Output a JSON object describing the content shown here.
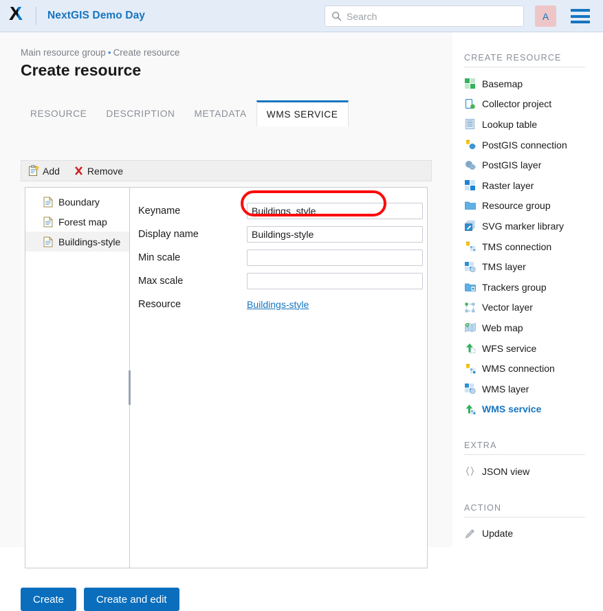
{
  "header": {
    "logo_name": "nextgis-logo",
    "site_title": "NextGIS Demo Day",
    "search_placeholder": "Search",
    "search_value": "",
    "avatar_letter": "A",
    "avatar_bg": "#eec6c8",
    "avatar_color": "#1675c0",
    "menu_name": "hamburger-menu",
    "bg": "#e4ecf7",
    "brand_color": "#1675c0"
  },
  "breadcrumb": {
    "parent": "Main resource group",
    "separator": "•",
    "current": "Create resource"
  },
  "page": {
    "title": "Create resource"
  },
  "tabs": [
    {
      "label": "RESOURCE",
      "active": false
    },
    {
      "label": "DESCRIPTION",
      "active": false
    },
    {
      "label": "METADATA",
      "active": false
    },
    {
      "label": "WMS SERVICE",
      "active": true
    }
  ],
  "toolbar": {
    "add_label": "Add",
    "remove_label": "Remove"
  },
  "item_list": [
    {
      "label": "Boundary",
      "selected": false
    },
    {
      "label": "Forest map",
      "selected": false
    },
    {
      "label": "Buildings-style",
      "selected": true
    }
  ],
  "form": {
    "rows": [
      {
        "label": "Keyname",
        "value": "Buildings_style",
        "type": "input"
      },
      {
        "label": "Display name",
        "value": "Buildings-style",
        "type": "input"
      },
      {
        "label": "Min scale",
        "value": "",
        "type": "input"
      },
      {
        "label": "Max scale",
        "value": "",
        "type": "input"
      },
      {
        "label": "Resource",
        "value": "Buildings-style",
        "type": "link"
      }
    ],
    "highlight_color": "#fc0b0b",
    "highlighted_field": "Keyname"
  },
  "buttons": {
    "create": "Create",
    "create_and_edit": "Create and edit",
    "primary_color": "#0a6ebd"
  },
  "sidebar": {
    "create_heading": "CREATE RESOURCE",
    "create_items": [
      {
        "label": "Basemap",
        "icon": "basemap-icon",
        "active": false
      },
      {
        "label": "Collector project",
        "icon": "collector-project-icon",
        "active": false
      },
      {
        "label": "Lookup table",
        "icon": "lookup-table-icon",
        "active": false
      },
      {
        "label": "PostGIS connection",
        "icon": "postgis-connection-icon",
        "active": false
      },
      {
        "label": "PostGIS layer",
        "icon": "postgis-layer-icon",
        "active": false
      },
      {
        "label": "Raster layer",
        "icon": "raster-layer-icon",
        "active": false
      },
      {
        "label": "Resource group",
        "icon": "resource-group-icon",
        "active": false
      },
      {
        "label": "SVG marker library",
        "icon": "svg-marker-library-icon",
        "active": false
      },
      {
        "label": "TMS connection",
        "icon": "tms-connection-icon",
        "active": false
      },
      {
        "label": "TMS layer",
        "icon": "tms-layer-icon",
        "active": false
      },
      {
        "label": "Trackers group",
        "icon": "trackers-group-icon",
        "active": false
      },
      {
        "label": "Vector layer",
        "icon": "vector-layer-icon",
        "active": false
      },
      {
        "label": "Web map",
        "icon": "web-map-icon",
        "active": false
      },
      {
        "label": "WFS service",
        "icon": "wfs-service-icon",
        "active": false
      },
      {
        "label": "WMS connection",
        "icon": "wms-connection-icon",
        "active": false
      },
      {
        "label": "WMS layer",
        "icon": "wms-layer-icon",
        "active": false
      },
      {
        "label": "WMS service",
        "icon": "wms-service-icon",
        "active": true
      }
    ],
    "extra_heading": "EXTRA",
    "extra_items": [
      {
        "label": "JSON view",
        "icon": "json-view-icon"
      }
    ],
    "action_heading": "ACTION",
    "action_items": [
      {
        "label": "Update",
        "icon": "pencil-icon"
      }
    ]
  }
}
